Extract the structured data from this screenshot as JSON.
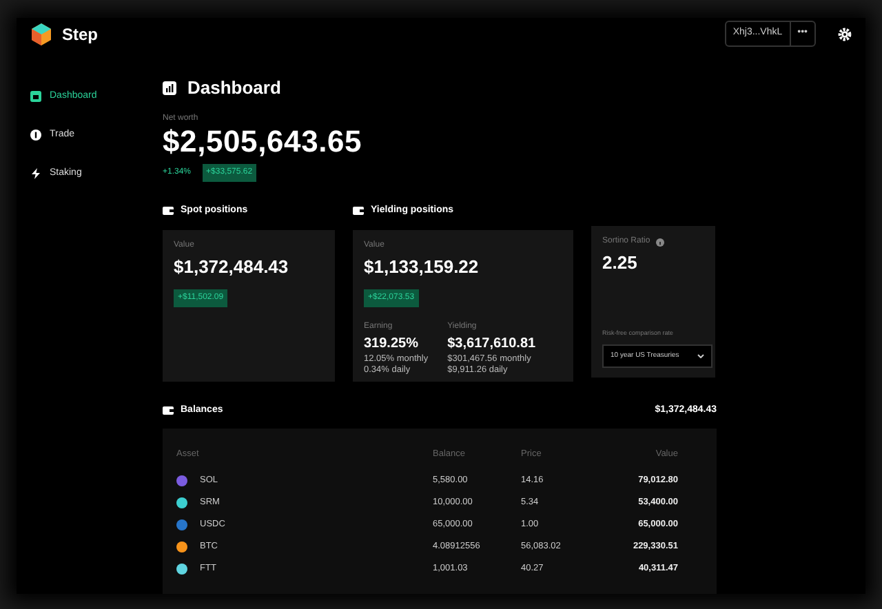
{
  "brand": "Step",
  "wallet": {
    "address": "Xhj3...VhkL",
    "menu": "•••"
  },
  "nav": [
    {
      "label": "Dashboard",
      "selected": true
    },
    {
      "label": "Trade",
      "selected": false
    },
    {
      "label": "Staking",
      "selected": false
    }
  ],
  "page_title": "Dashboard",
  "net_worth": {
    "label": "Net worth",
    "value": "$2,505,643.65",
    "change_pct": "+1.34%",
    "change_value": "+$33,575.62"
  },
  "spot": {
    "title": "Spot positions",
    "label": "Value",
    "value": "$1,372,484.43",
    "change": "+$11,502.09"
  },
  "yielding": {
    "title": "Yielding positions",
    "label": "Value",
    "value": "$1,133,159.22",
    "change": "+$22,073.53",
    "stats": [
      {
        "label": "Earning",
        "value": "319.25%",
        "lines": [
          "12.05% monthly",
          "0.34% daily"
        ]
      },
      {
        "label": "Yielding",
        "value": "$3,617,610.81",
        "lines": [
          "$301,467.56 monthly",
          "$9,911.26 daily"
        ]
      }
    ]
  },
  "sortino": {
    "label": "Sortino Ratio",
    "value": "2.25",
    "rate_label": "Risk-free comparison rate",
    "rate_value": "10 year US Treasuries"
  },
  "balances": {
    "title": "Balances",
    "total": "$1,372,484.43",
    "columns": [
      "Asset",
      "Balance",
      "Price",
      "Value"
    ],
    "rows": [
      {
        "asset": "SOL",
        "color": "#7b5ce0",
        "balance": "5,580.00",
        "price": "14.16",
        "value": "79,012.80"
      },
      {
        "asset": "SRM",
        "color": "#3ccfd0",
        "balance": "10,000.00",
        "price": "5.34",
        "value": "53,400.00"
      },
      {
        "asset": "USDC",
        "color": "#2775ca",
        "balance": "65,000.00",
        "price": "1.00",
        "value": "65,000.00"
      },
      {
        "asset": "BTC",
        "color": "#f7931a",
        "balance": "4.08912556",
        "price": "56,083.02",
        "value": "229,330.51"
      },
      {
        "asset": "FTT",
        "color": "#5fd4e0",
        "balance": "1,001.03",
        "price": "40.27",
        "value": "40,311.47"
      }
    ]
  }
}
